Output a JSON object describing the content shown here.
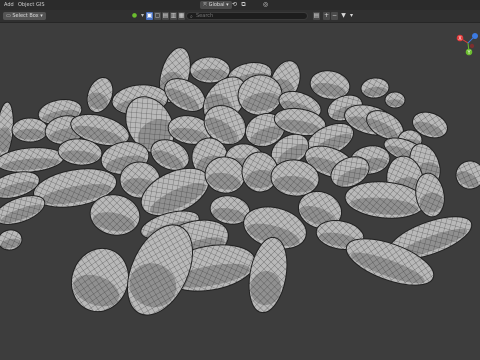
{
  "menubar": {
    "items": [
      {
        "label": "Add"
      },
      {
        "label": "Object"
      },
      {
        "label": "GIS"
      }
    ]
  },
  "header": {
    "select_mode": "Select Box",
    "transform_orientation": "Global",
    "search_placeholder": "Search"
  },
  "gizmo": {
    "axes": [
      {
        "label": "X",
        "color": "#e33c3c"
      },
      {
        "label": "Y",
        "color": "#6bbe2e"
      },
      {
        "label": "Z",
        "color": "#3c7be3"
      }
    ]
  },
  "colors": {
    "viewport_bg": "#3d3d3d",
    "seed_fill": "#b8b8b8",
    "wire": "#3a3a3a",
    "active_icon": "#4a73c4"
  },
  "icons": [
    "select-box-icon",
    "view-icon",
    "transform-orientation-icon",
    "snap-icon",
    "proportional-edit-icon",
    "filter-icon",
    "search-icon",
    "navigation-gizmo-icon"
  ]
}
